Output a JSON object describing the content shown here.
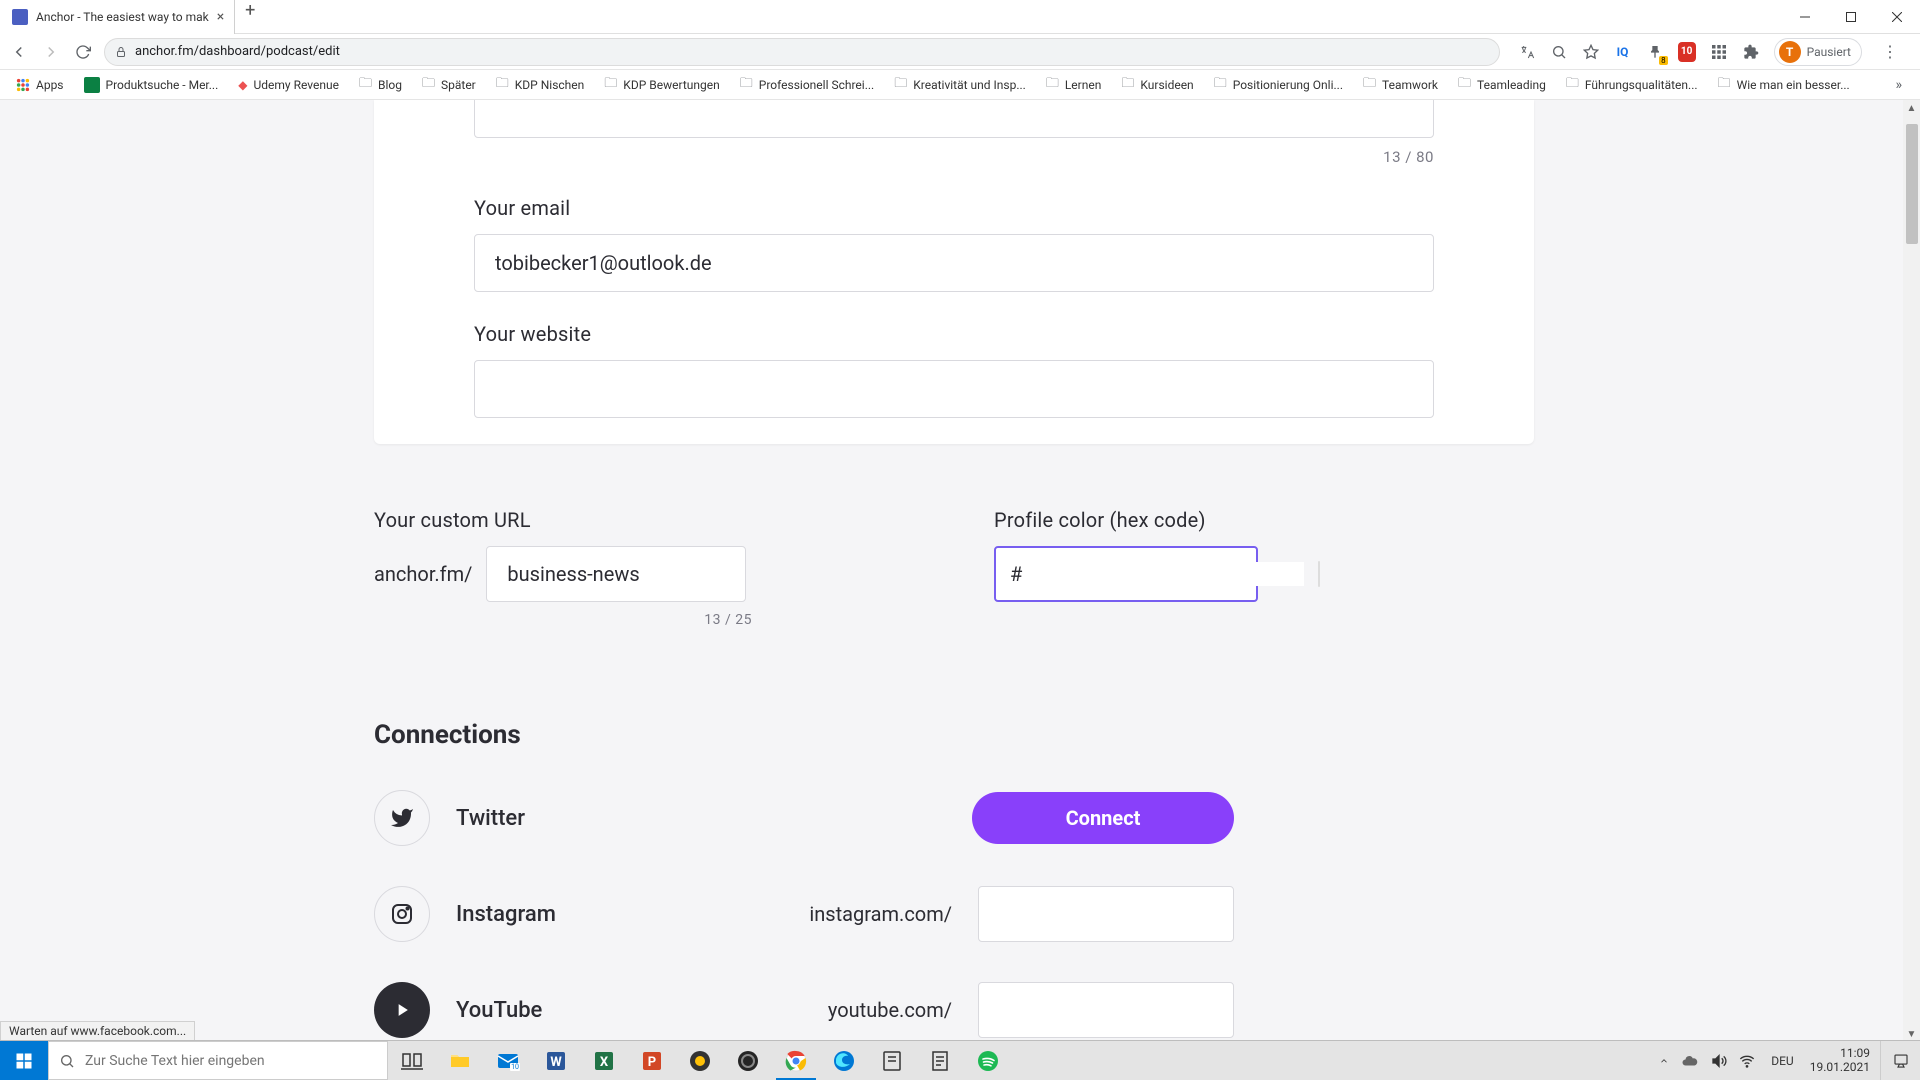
{
  "tab": {
    "title": "Anchor - The easiest way to mak"
  },
  "url": "anchor.fm/dashboard/podcast/edit",
  "profile_chip": {
    "initial": "T",
    "label": "Pausiert"
  },
  "bookmarks": [
    "Apps",
    "Produktsuche - Mer...",
    "Udemy Revenue",
    "Blog",
    "Später",
    "KDP Nischen",
    "KDP Bewertungen",
    "Professionell Schrei...",
    "Kreativität und Insp...",
    "Lernen",
    "Kursideen",
    "Positionierung Onli...",
    "Teamwork",
    "Teamleading",
    "Führungsqualitäten...",
    "Wie man ein besser..."
  ],
  "form": {
    "name_counter": "13 / 80",
    "email_label": "Your email",
    "email_value": "tobibecker1@outlook.de",
    "website_label": "Your website",
    "website_value": "",
    "custom_url_label": "Your custom URL",
    "custom_url_prefix": "anchor.fm/",
    "custom_url_value": "business-news",
    "custom_url_counter": "13 / 25",
    "color_label": "Profile color (hex code)",
    "color_hash": "#",
    "color_value": ""
  },
  "connections": {
    "heading": "Connections",
    "twitter": "Twitter",
    "instagram": "Instagram",
    "instagram_prefix": "instagram.com/",
    "youtube": "YouTube",
    "youtube_prefix": "youtube.com/",
    "connect_btn": "Connect"
  },
  "status": "Warten auf www.facebook.com...",
  "taskbar": {
    "search_placeholder": "Zur Suche Text hier eingeben",
    "lang": "DEU",
    "time": "11:09",
    "date": "19.01.2021"
  }
}
